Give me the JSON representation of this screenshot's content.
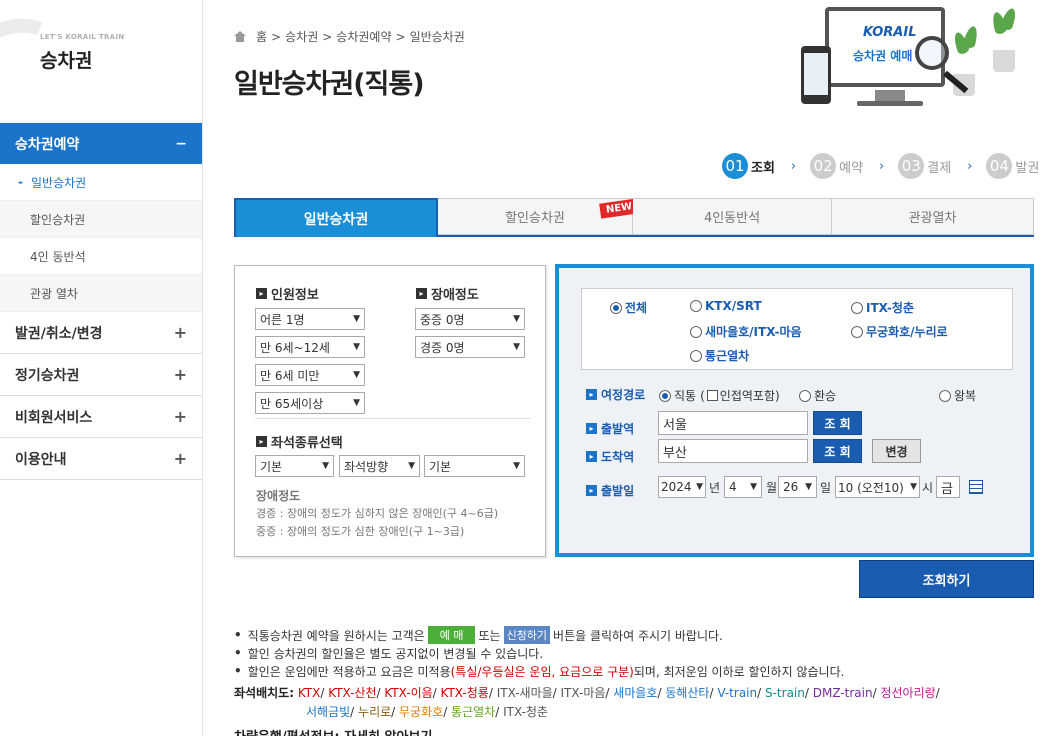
{
  "sidebar": {
    "brand_sub": "LET'S KORAIL TRAIN",
    "brand_title": "승차권",
    "active_menu": "승차권예약",
    "active_toggle": "−",
    "sub_items": [
      "일반승차권",
      "할인승차권",
      "4인 동반석",
      "관광 열차"
    ],
    "menu_items": [
      "발권/취소/변경",
      "정기승차권",
      "비회원서비스",
      "이용안내"
    ],
    "plus": "+"
  },
  "breadcrumb": [
    "홈",
    "승차권",
    "승차권예약",
    "일반승차권"
  ],
  "breadcrumb_sep": ">",
  "page_title": "일반승차권(직통)",
  "promo": {
    "logo": "KORAIL",
    "text": "승차권 예매"
  },
  "steps": [
    {
      "num": "01",
      "label": "조회"
    },
    {
      "num": "02",
      "label": "예약"
    },
    {
      "num": "03",
      "label": "결제"
    },
    {
      "num": "04",
      "label": "발권"
    }
  ],
  "step_arrow": "›",
  "tabs": [
    "일반승차권",
    "할인승차권",
    "4인동반석",
    "관광열차"
  ],
  "new_badge": "NEW",
  "passengers": {
    "title": "인원정보",
    "options": [
      "어른 1명",
      "만 6세~12세",
      "만 6세 미만",
      "만 65세이상"
    ]
  },
  "disability": {
    "title": "장애정도",
    "options": [
      "중증 0명",
      "경증 0명"
    ]
  },
  "seat_type": {
    "title": "좌석종류선택",
    "options": [
      "기본",
      "좌석방향",
      "기본"
    ]
  },
  "disability_note": {
    "title": "장애정도",
    "line1": "경증 : 장애의 정도가 심하지 않은 장애인(구 4~6급)",
    "line2": "중증 : 장애의 정도가 심한 장애인(구 1~3급)"
  },
  "train_types": [
    "전체",
    "KTX/SRT",
    "ITX-청춘",
    "새마을호/ITX-마음",
    "무궁화호/누리로",
    "통근열차"
  ],
  "route": {
    "label": "여정경로",
    "direct": "직통",
    "adjacent_open": "(",
    "adjacent": "인접역포함)",
    "transfer": "환승",
    "round": "왕복"
  },
  "departure": {
    "label": "출발역",
    "value": "서울",
    "btn": "조 회"
  },
  "arrival": {
    "label": "도착역",
    "value": "부산",
    "btn": "조 회",
    "swap": "변경"
  },
  "date": {
    "label": "출발일",
    "year": "2024",
    "year_unit": "년",
    "month": "4",
    "month_unit": "월",
    "day": "26",
    "day_unit": "일",
    "hour": "10 (오전10)",
    "hour_unit": "시",
    "weekday": "금"
  },
  "search_button": "조회하기",
  "notes": {
    "n1_a": "직통승차권 예약을 원하시는 고객은",
    "n1_btn1": "예 매",
    "n1_b": "또는",
    "n1_btn2": "신청하기",
    "n1_c": "버튼을 클릭하여 주시기 바랍니다.",
    "n2": "할인 승차권의 할인율은 별도 공지없이 변경될 수 있습니다.",
    "n3_a": "할인은 운임에만 적용하고 요금은 미적용",
    "n3_red": "(특실/우등실은 운임, 요금으로 구분)",
    "n3_b": "되며, 최저운임 이하로 할인하지 않습니다."
  },
  "seat_layout": {
    "label": "좌석배치도:",
    "items": [
      "KTX",
      "KTX-산천",
      "KTX-이음",
      "KTX-청룡",
      "ITX-새마을",
      "ITX-마음",
      "새마을호",
      "동해산타",
      "V-train",
      "S-train",
      "DMZ-train",
      "정선아리랑",
      "서해금빛",
      "누리로",
      "무궁화호",
      "통근열차",
      "ITX-청춘"
    ]
  },
  "bottom_cut": "차량운행/편성정보: 자세히 알아보기"
}
